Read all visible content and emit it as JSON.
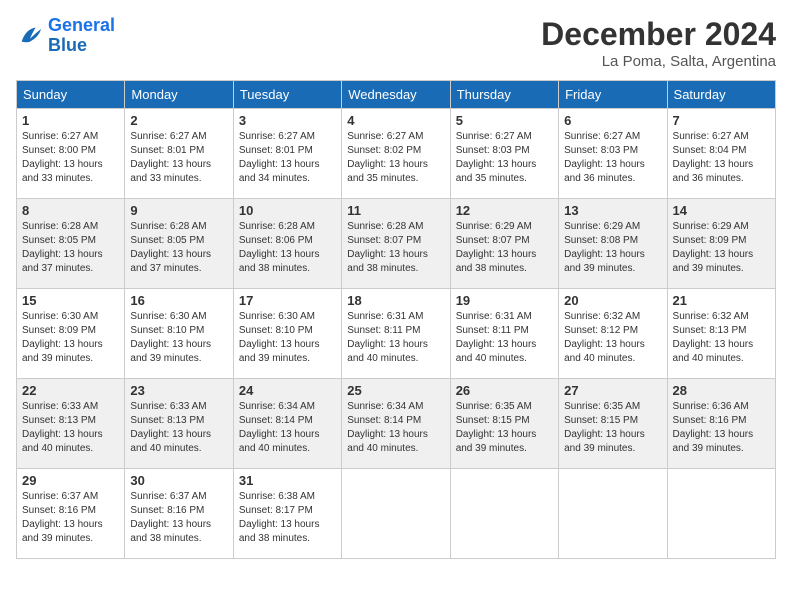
{
  "logo": {
    "line1": "General",
    "line2": "Blue"
  },
  "title": "December 2024",
  "subtitle": "La Poma, Salta, Argentina",
  "days_of_week": [
    "Sunday",
    "Monday",
    "Tuesday",
    "Wednesday",
    "Thursday",
    "Friday",
    "Saturday"
  ],
  "weeks": [
    [
      {
        "day": "1",
        "sunrise": "6:27 AM",
        "sunset": "8:00 PM",
        "daylight": "13 hours and 33 minutes."
      },
      {
        "day": "2",
        "sunrise": "6:27 AM",
        "sunset": "8:01 PM",
        "daylight": "13 hours and 33 minutes."
      },
      {
        "day": "3",
        "sunrise": "6:27 AM",
        "sunset": "8:01 PM",
        "daylight": "13 hours and 34 minutes."
      },
      {
        "day": "4",
        "sunrise": "6:27 AM",
        "sunset": "8:02 PM",
        "daylight": "13 hours and 35 minutes."
      },
      {
        "day": "5",
        "sunrise": "6:27 AM",
        "sunset": "8:03 PM",
        "daylight": "13 hours and 35 minutes."
      },
      {
        "day": "6",
        "sunrise": "6:27 AM",
        "sunset": "8:03 PM",
        "daylight": "13 hours and 36 minutes."
      },
      {
        "day": "7",
        "sunrise": "6:27 AM",
        "sunset": "8:04 PM",
        "daylight": "13 hours and 36 minutes."
      }
    ],
    [
      {
        "day": "8",
        "sunrise": "6:28 AM",
        "sunset": "8:05 PM",
        "daylight": "13 hours and 37 minutes."
      },
      {
        "day": "9",
        "sunrise": "6:28 AM",
        "sunset": "8:05 PM",
        "daylight": "13 hours and 37 minutes."
      },
      {
        "day": "10",
        "sunrise": "6:28 AM",
        "sunset": "8:06 PM",
        "daylight": "13 hours and 38 minutes."
      },
      {
        "day": "11",
        "sunrise": "6:28 AM",
        "sunset": "8:07 PM",
        "daylight": "13 hours and 38 minutes."
      },
      {
        "day": "12",
        "sunrise": "6:29 AM",
        "sunset": "8:07 PM",
        "daylight": "13 hours and 38 minutes."
      },
      {
        "day": "13",
        "sunrise": "6:29 AM",
        "sunset": "8:08 PM",
        "daylight": "13 hours and 39 minutes."
      },
      {
        "day": "14",
        "sunrise": "6:29 AM",
        "sunset": "8:09 PM",
        "daylight": "13 hours and 39 minutes."
      }
    ],
    [
      {
        "day": "15",
        "sunrise": "6:30 AM",
        "sunset": "8:09 PM",
        "daylight": "13 hours and 39 minutes."
      },
      {
        "day": "16",
        "sunrise": "6:30 AM",
        "sunset": "8:10 PM",
        "daylight": "13 hours and 39 minutes."
      },
      {
        "day": "17",
        "sunrise": "6:30 AM",
        "sunset": "8:10 PM",
        "daylight": "13 hours and 39 minutes."
      },
      {
        "day": "18",
        "sunrise": "6:31 AM",
        "sunset": "8:11 PM",
        "daylight": "13 hours and 40 minutes."
      },
      {
        "day": "19",
        "sunrise": "6:31 AM",
        "sunset": "8:11 PM",
        "daylight": "13 hours and 40 minutes."
      },
      {
        "day": "20",
        "sunrise": "6:32 AM",
        "sunset": "8:12 PM",
        "daylight": "13 hours and 40 minutes."
      },
      {
        "day": "21",
        "sunrise": "6:32 AM",
        "sunset": "8:13 PM",
        "daylight": "13 hours and 40 minutes."
      }
    ],
    [
      {
        "day": "22",
        "sunrise": "6:33 AM",
        "sunset": "8:13 PM",
        "daylight": "13 hours and 40 minutes."
      },
      {
        "day": "23",
        "sunrise": "6:33 AM",
        "sunset": "8:13 PM",
        "daylight": "13 hours and 40 minutes."
      },
      {
        "day": "24",
        "sunrise": "6:34 AM",
        "sunset": "8:14 PM",
        "daylight": "13 hours and 40 minutes."
      },
      {
        "day": "25",
        "sunrise": "6:34 AM",
        "sunset": "8:14 PM",
        "daylight": "13 hours and 40 minutes."
      },
      {
        "day": "26",
        "sunrise": "6:35 AM",
        "sunset": "8:15 PM",
        "daylight": "13 hours and 39 minutes."
      },
      {
        "day": "27",
        "sunrise": "6:35 AM",
        "sunset": "8:15 PM",
        "daylight": "13 hours and 39 minutes."
      },
      {
        "day": "28",
        "sunrise": "6:36 AM",
        "sunset": "8:16 PM",
        "daylight": "13 hours and 39 minutes."
      }
    ],
    [
      {
        "day": "29",
        "sunrise": "6:37 AM",
        "sunset": "8:16 PM",
        "daylight": "13 hours and 39 minutes."
      },
      {
        "day": "30",
        "sunrise": "6:37 AM",
        "sunset": "8:16 PM",
        "daylight": "13 hours and 38 minutes."
      },
      {
        "day": "31",
        "sunrise": "6:38 AM",
        "sunset": "8:17 PM",
        "daylight": "13 hours and 38 minutes."
      },
      null,
      null,
      null,
      null
    ]
  ]
}
